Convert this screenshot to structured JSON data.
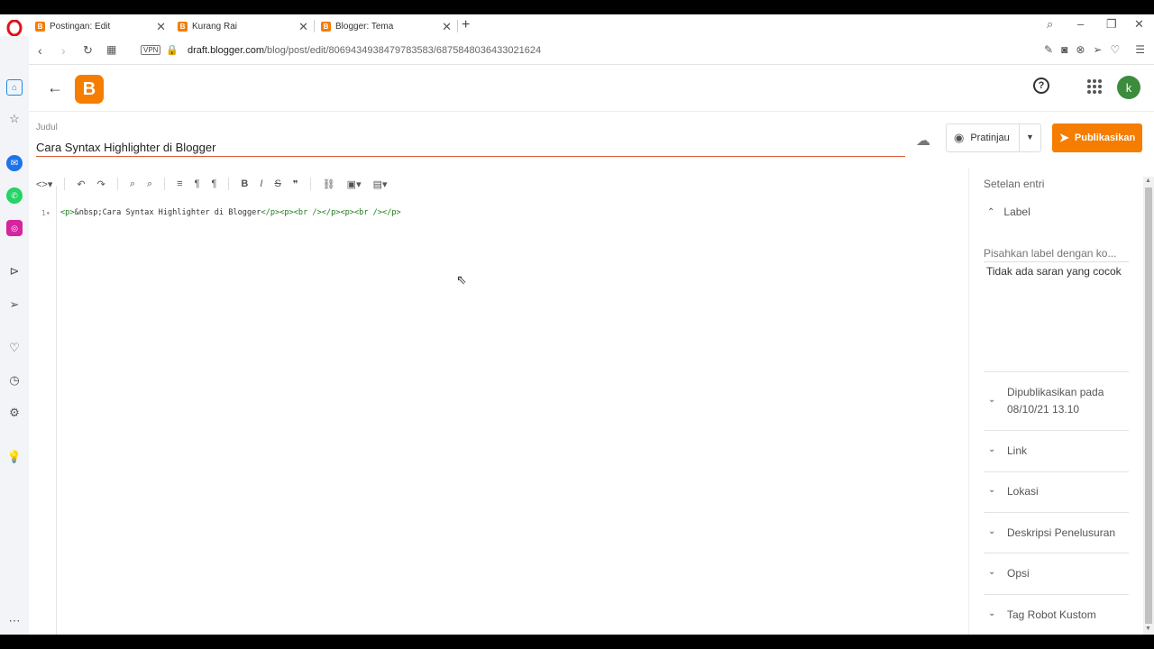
{
  "browser": {
    "tabs": [
      {
        "label": "Postingan: Edit",
        "active": true
      },
      {
        "label": "Kurang Rai",
        "active": false
      },
      {
        "label": "Blogger: Tema",
        "active": false
      }
    ],
    "url_domain": "draft.blogger.com",
    "url_path": "/blog/post/edit/8069434938479783583/6875848036433021624",
    "vpn_label": "VPN",
    "new_tab_glyph": "+"
  },
  "header": {
    "logo_letter": "B",
    "avatar_letter": "k",
    "help_glyph": "?"
  },
  "post": {
    "title_label": "Judul",
    "title_value": "Cara Syntax Highlighter di Blogger"
  },
  "actions": {
    "preview_label": "Pratinjau",
    "publish_label": "Publikasikan"
  },
  "editor": {
    "line_number": "1",
    "code_prefix": "<p>",
    "code_text": "&nbsp;Cara Syntax Highlighter di Blogger",
    "code_suffix": "</p><p><br /></p><p><br /></p>"
  },
  "settings": {
    "title": "Setelan entri",
    "label_section": "Label",
    "label_placeholder": "Pisahkan label dengan ko...",
    "no_suggestions": "Tidak ada saran yang cocok",
    "published_label": "Dipublikasikan pada",
    "published_date": "08/10/21 13.10",
    "link": "Link",
    "location": "Lokasi",
    "search_description": "Deskripsi Penelusuran",
    "options": "Opsi",
    "robot_tags": "Tag Robot Kustom"
  },
  "colors": {
    "brand": "#f57d00",
    "title_underline": "#d95b3a",
    "avatar": "#3b8c3b"
  }
}
